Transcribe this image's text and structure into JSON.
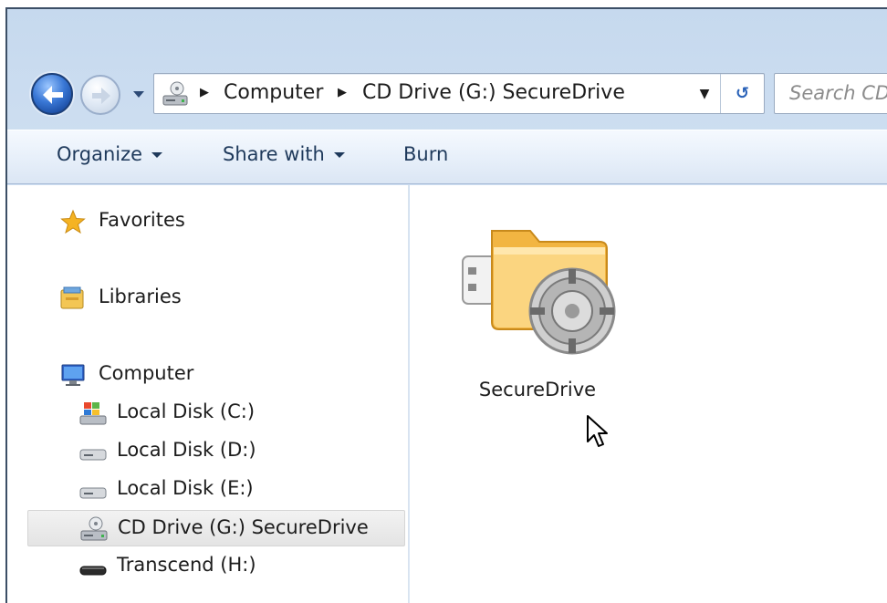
{
  "navigation": {
    "back_icon": "back-arrow-icon",
    "forward_icon": "forward-arrow-icon",
    "address": {
      "drive_icon": "cd-drive-icon",
      "crumbs": [
        "Computer",
        "CD Drive (G:) SecureDrive"
      ],
      "separator": "▶",
      "dropdown": "▼",
      "refresh": "↺"
    },
    "search": {
      "placeholder": "Search CD"
    }
  },
  "commandbar": {
    "organize": "Organize",
    "share_with": "Share with",
    "burn": "Burn"
  },
  "navpane": {
    "favorites": "Favorites",
    "libraries": "Libraries",
    "computer": "Computer",
    "drives": [
      {
        "label": "Local Disk (C:)",
        "icon": "windows-drive-icon"
      },
      {
        "label": "Local Disk (D:)",
        "icon": "hard-drive-icon"
      },
      {
        "label": "Local Disk (E:)",
        "icon": "hard-drive-icon"
      },
      {
        "label": "CD Drive (G:) SecureDrive",
        "icon": "cd-drive-icon",
        "selected": true
      },
      {
        "label": "Transcend (H:)",
        "icon": "usb-drive-icon"
      }
    ]
  },
  "content": {
    "items": [
      {
        "label": "SecureDrive",
        "icon": "secure-usb-folder-icon"
      }
    ]
  },
  "colors": {
    "chrome": "#d3e2f3",
    "selection": "#e8e8e8",
    "text": "#1c1c1c",
    "command_text": "#1e395b"
  }
}
